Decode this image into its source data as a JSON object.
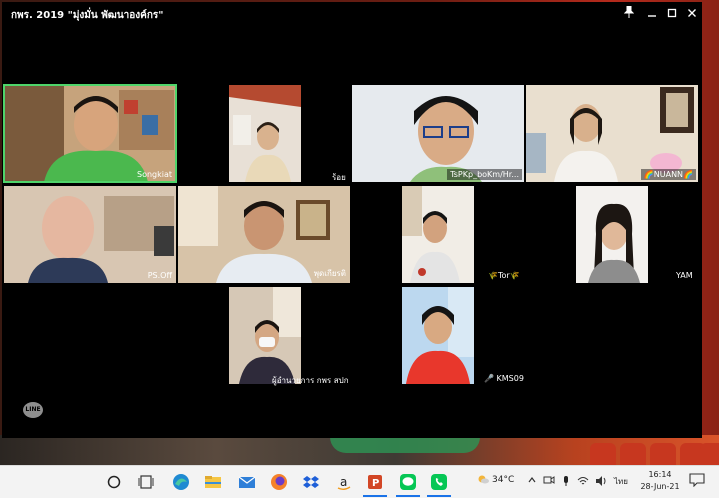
{
  "window": {
    "title": "กพร. 2019 \"มุ่งมั่น พัฒนาองค์กร\"",
    "pin_icon": "pin-icon",
    "minimize_icon": "minimize-icon",
    "maximize_icon": "maximize-icon",
    "close_icon": "close-icon"
  },
  "participants": [
    {
      "name": "Songkiat",
      "active": true
    },
    {
      "name": "ร้อย",
      "active": false
    },
    {
      "name": "TsPKp_boKm/Hr...",
      "active": false
    },
    {
      "name": "🌈NUANN🌈",
      "active": false
    },
    {
      "name": "PS.Off",
      "active": false
    },
    {
      "name": "พุดเกียรติ",
      "active": false
    },
    {
      "name": "🌾Tor🌾",
      "active": false
    },
    {
      "name": "YAM",
      "active": false
    },
    {
      "name": "ผู้อำนวยการ กพร สปก",
      "active": false
    },
    {
      "name": "🎤 KMS09",
      "active": false
    }
  ],
  "logo": "LINE",
  "taskbar": {
    "temperature": "34°C",
    "language": "ไทย",
    "time": "16:14",
    "date": "28-Jun-21",
    "icons": [
      "search-circle-icon",
      "task-view-icon",
      "edge-icon",
      "file-explorer-icon",
      "mail-icon",
      "firefox-icon",
      "dropbox-icon",
      "amazon-icon",
      "powerpoint-icon",
      "line-app-icon",
      "line-call-icon"
    ]
  },
  "colors": {
    "active_border": "#4fd46a",
    "window_bg": "#000000",
    "taskbar_bg": "#f3f3f3"
  }
}
